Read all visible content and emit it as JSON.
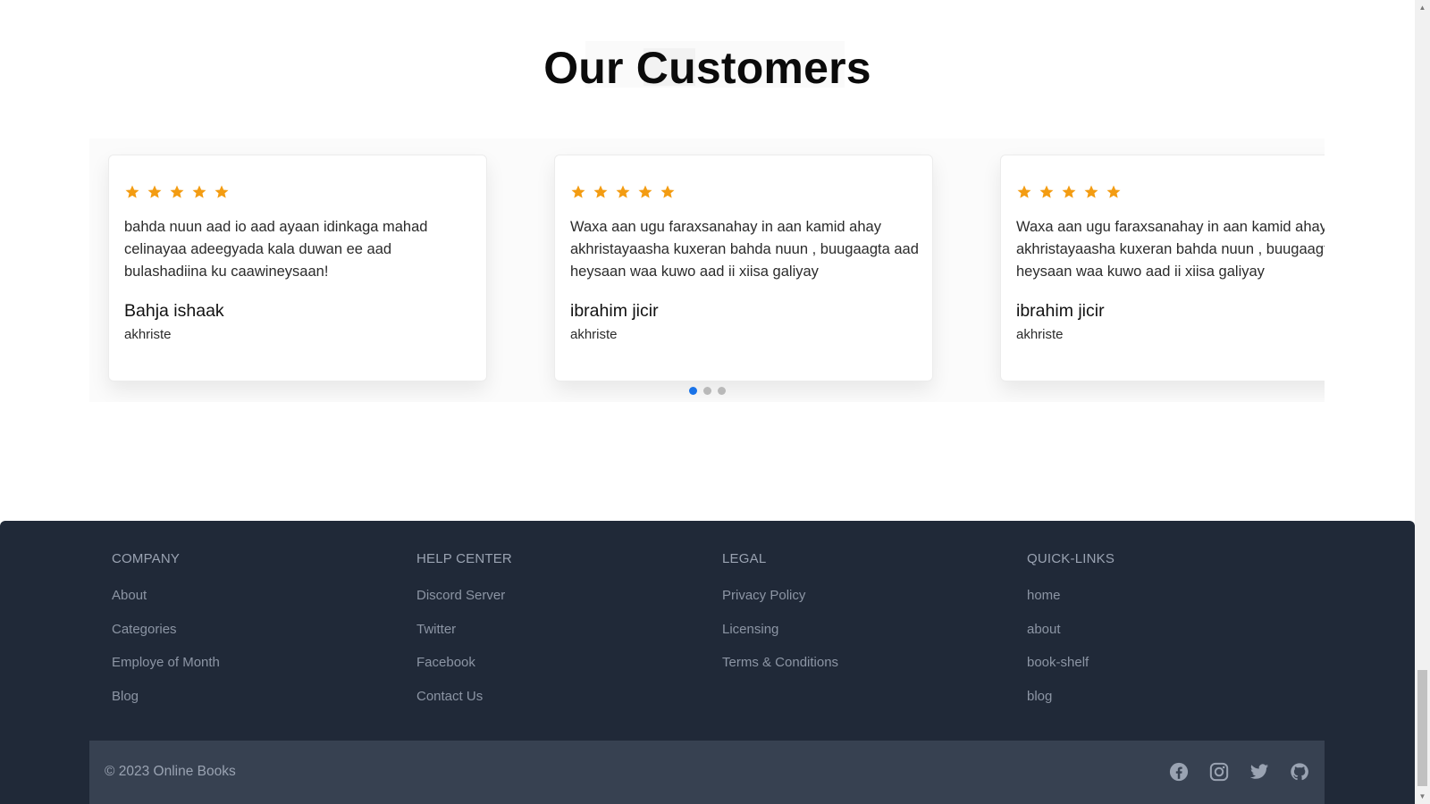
{
  "section": {
    "title": "Our Customers"
  },
  "testimonials": [
    {
      "rating": 5,
      "quote": "bahda nuun aad io aad ayaan idinkaga mahad celinayaa adeegyada kala duwan ee aad bulashadiina ku caawineysaan!",
      "name": "Bahja ishaak",
      "role": "akhriste"
    },
    {
      "rating": 5,
      "quote": "Waxa aan ugu faraxsanahay in aan kamid ahay akhristayaasha kuxeran bahda nuun , buugaagta aad heysaan waa kuwo aad ii xiisa galiyay",
      "name": "ibrahim jicir",
      "role": "akhriste"
    },
    {
      "rating": 5,
      "quote": "Waxa aan ugu faraxsanahay in aan kamid ahay akhristayaasha kuxeran bahda nuun , buugaagta aad heysaan waa kuwo aad ii xiisa galiyay",
      "name": "ibrahim jicir",
      "role": "akhriste"
    }
  ],
  "carousel": {
    "page_count": 3,
    "active_index": 0
  },
  "footer": {
    "columns": [
      {
        "title": "COMPANY",
        "links": [
          "About",
          "Categories",
          "Employe of Month",
          "Blog"
        ]
      },
      {
        "title": "HELP CENTER",
        "links": [
          "Discord Server",
          "Twitter",
          "Facebook",
          "Contact Us"
        ]
      },
      {
        "title": "LEGAL",
        "links": [
          "Privacy Policy",
          "Licensing",
          "Terms & Conditions"
        ]
      },
      {
        "title": "QUICK-LINKS",
        "links": [
          "home",
          "about",
          "book-shelf",
          "blog"
        ]
      }
    ],
    "copyright": "© 2023 Online Books",
    "socials": [
      "facebook-icon",
      "instagram-icon",
      "twitter-icon",
      "github-icon"
    ]
  },
  "colors": {
    "star": "#f39c12",
    "dot_active": "#1a73e8",
    "footer_bg": "#202938",
    "footer_bottom_bg": "#374151",
    "social_icon": "#9aa3b2"
  }
}
